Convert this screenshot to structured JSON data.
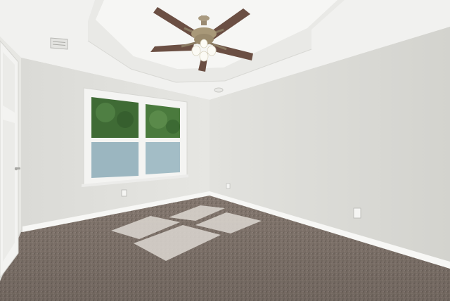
{
  "scene": {
    "kind": "photo",
    "subject": "empty-bedroom",
    "colors": {
      "ceiling": "#f2f2f0",
      "tray_inner": "#f5f5f3",
      "left_wall": "#e3e3df",
      "right_wall": "#dcdcd7",
      "back_wall": "#e8e8e4",
      "baseboard": "#f7f7f5",
      "carpet": "#8a7d74",
      "carpet_dark": "#6f645c",
      "window_frame": "#f4f4f2",
      "window_glass": "#9bb6c0",
      "foliage": "#3f6b35",
      "door": "#f3f3f1",
      "fan_blade": "#6b4f43",
      "fan_body": "#9a8a72",
      "light_patch": "#ddd8d2"
    }
  }
}
